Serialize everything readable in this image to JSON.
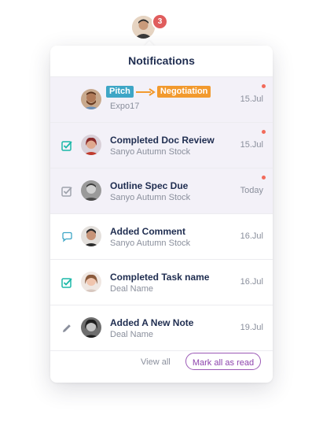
{
  "header": {
    "notification_count": "3",
    "title": "Notifications"
  },
  "notifications": [
    {
      "type": "stage-change",
      "status_icon": "none",
      "from_stage": "Pitch",
      "to_stage": "Negotiation",
      "subtitle": "Expo17",
      "date": "15.Jul",
      "unread": true
    },
    {
      "type": "task",
      "status_icon": "check-square-icon",
      "title": "Completed Doc Review",
      "subtitle": "Sanyo Autumn Stock",
      "date": "15.Jul",
      "unread": true
    },
    {
      "type": "task",
      "status_icon": "check-square-icon",
      "title": "Outline Spec Due",
      "subtitle": "Sanyo Autumn Stock",
      "date": "Today",
      "unread": true
    },
    {
      "type": "comment",
      "status_icon": "comment-icon",
      "title": "Added Comment",
      "subtitle": "Sanyo Autumn Stock",
      "date": "16.Jul",
      "unread": false
    },
    {
      "type": "task",
      "status_icon": "check-square-icon",
      "title": "Completed Task name",
      "subtitle": "Deal Name",
      "date": "16.Jul",
      "unread": false
    },
    {
      "type": "note",
      "status_icon": "pencil-icon",
      "title": "Added A New Note",
      "subtitle": "Deal Name",
      "date": "19.Jul",
      "unread": false
    }
  ],
  "footer": {
    "view_all_label": "View all",
    "mark_all_read_label": "Mark all as read"
  },
  "colors": {
    "unread_bg": "#f3f1f8",
    "unread_dot": "#f26b5b",
    "badge": "#e05d5d",
    "check_teal": "#1bb8a8",
    "comment_blue": "#3ea6c6",
    "accent_purple": "#9b59b6",
    "pill_blue": "#3ea6c6",
    "pill_orange": "#f29a2e"
  }
}
